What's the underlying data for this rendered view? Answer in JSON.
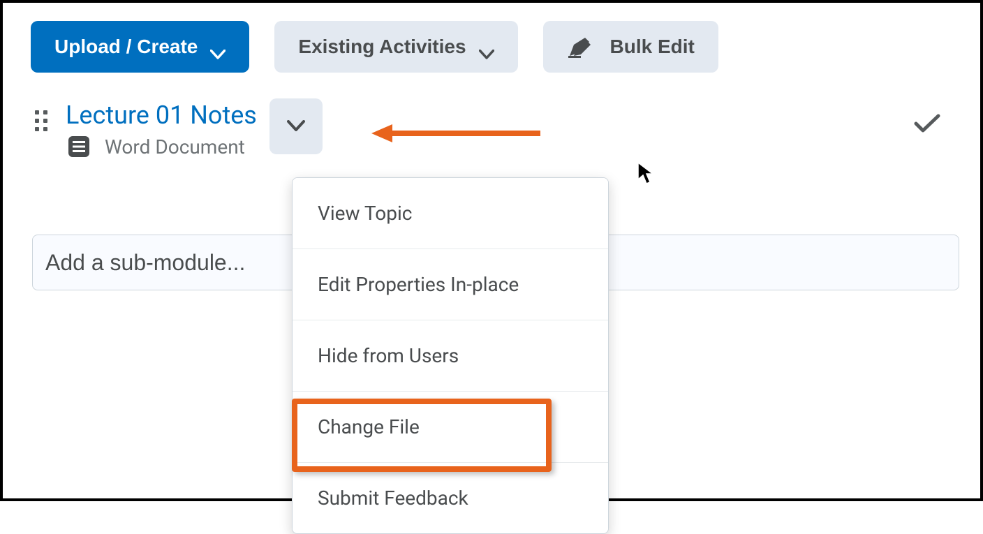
{
  "toolbar": {
    "upload_label": "Upload / Create",
    "existing_label": "Existing Activities",
    "bulk_label": "Bulk Edit"
  },
  "content_item": {
    "title": "Lecture 01 Notes",
    "type_label": "Word Document"
  },
  "submodule": {
    "placeholder": "Add a sub-module..."
  },
  "menu": {
    "items": [
      "View Topic",
      "Edit Properties In-place",
      "Hide from Users",
      "Change File",
      "Submit Feedback"
    ]
  }
}
